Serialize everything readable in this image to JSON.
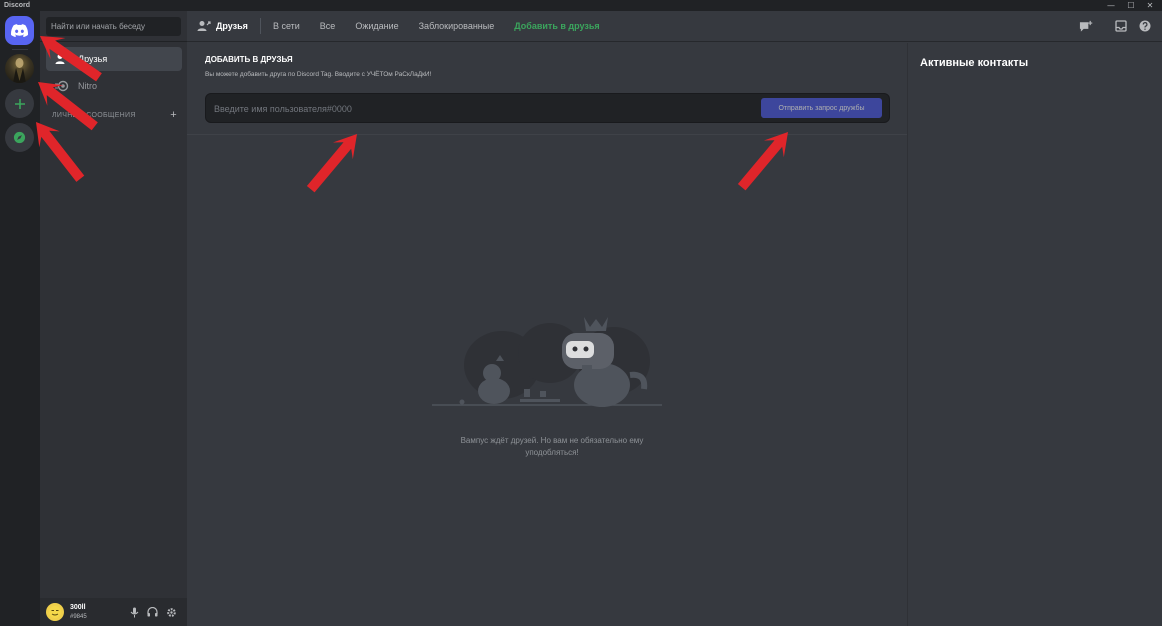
{
  "window": {
    "title": "Discord",
    "minimize_glyph": "—",
    "maximize_glyph": "☐",
    "close_glyph": "✕"
  },
  "servers": [
    {
      "name": "discord-home-icon"
    },
    {
      "name": "server-avatar"
    },
    {
      "name": "add-server-icon"
    },
    {
      "name": "explore-servers-icon"
    }
  ],
  "sidebar": {
    "search_placeholder": "Найти или начать беседу",
    "items": [
      {
        "label": "Друзья",
        "icon": "friends-icon"
      },
      {
        "label": "Nitro",
        "icon": "nitro-icon"
      }
    ],
    "dm_header": "Личные сообщения",
    "dm_add_glyph": "+"
  },
  "user": {
    "name": "300ll",
    "tag": "#9845"
  },
  "topbar": {
    "friends_label": "Друзья",
    "tabs": [
      {
        "label": "В сети"
      },
      {
        "label": "Все"
      },
      {
        "label": "Ожидание"
      },
      {
        "label": "Заблокированные"
      }
    ],
    "add_friend_tab": "Добавить в друзья"
  },
  "add_friend": {
    "title": "Добавить в друзья",
    "subtitle": "Вы можете добавить друга по Discord Tag. Вводите с УЧЁТОм РаСкЛаДкИ!",
    "input_placeholder": "Введите имя пользователя#0000",
    "button_label": "Отправить запрос дружбы"
  },
  "empty_state": {
    "text": "Вампус ждёт друзей. Но вам не обязательно ему уподобляться!"
  },
  "activity": {
    "title": "Активные контакты"
  },
  "colors": {
    "blurple": "#5865f2",
    "green": "#3ba55d",
    "arrow_red": "#e0252a"
  }
}
